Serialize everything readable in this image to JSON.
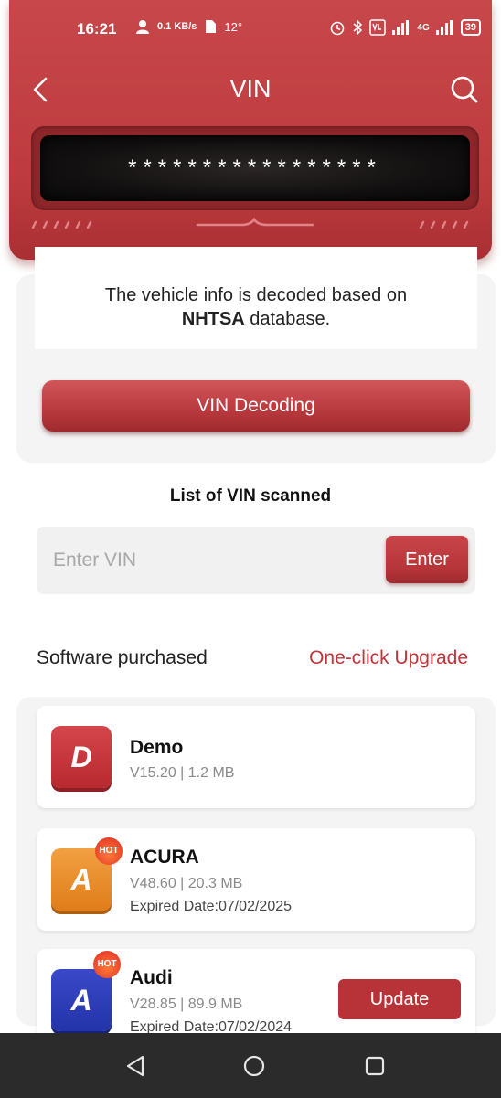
{
  "status_bar": {
    "time": "16:21",
    "net_speed": "0.1 KB/s",
    "temperature": "12°",
    "network": "4G",
    "battery": "39"
  },
  "nav": {
    "title": "VIN",
    "back_icon": "chevron-left-icon",
    "search_icon": "search-icon"
  },
  "vin_display": {
    "value": "*****************"
  },
  "info": {
    "text_before": "The vehicle info is decoded based on",
    "database": "NHTSA",
    "text_after": " database."
  },
  "decode_button": "VIN Decoding",
  "vin_list": {
    "title": "List of VIN scanned",
    "input_placeholder": "Enter VIN",
    "enter_button": "Enter"
  },
  "software": {
    "title": "Software purchased",
    "upgrade_link": "One-click Upgrade",
    "items": [
      {
        "icon_letter": "D",
        "name": "Demo",
        "meta": "V15.20 | 1.2 MB",
        "hot": false,
        "expired": "",
        "action": "",
        "color": "#c63237"
      },
      {
        "icon_letter": "A",
        "name": "ACURA",
        "meta": "V48.60 | 20.3 MB",
        "hot": true,
        "hot_label": "HOT",
        "expired": "Expired Date:07/02/2025",
        "action": "",
        "color": "#e8892a"
      },
      {
        "icon_letter": "A",
        "name": "Audi",
        "meta": "V28.85 | 89.9 MB",
        "hot": true,
        "hot_label": "HOT",
        "expired": "Expired Date:07/02/2024",
        "action": "Update",
        "color": "#2b3bb6"
      }
    ]
  },
  "colors": {
    "brand_red": "#bd3b3e",
    "accent_text": "#c0343a",
    "navbar": "#2b2b2b"
  }
}
